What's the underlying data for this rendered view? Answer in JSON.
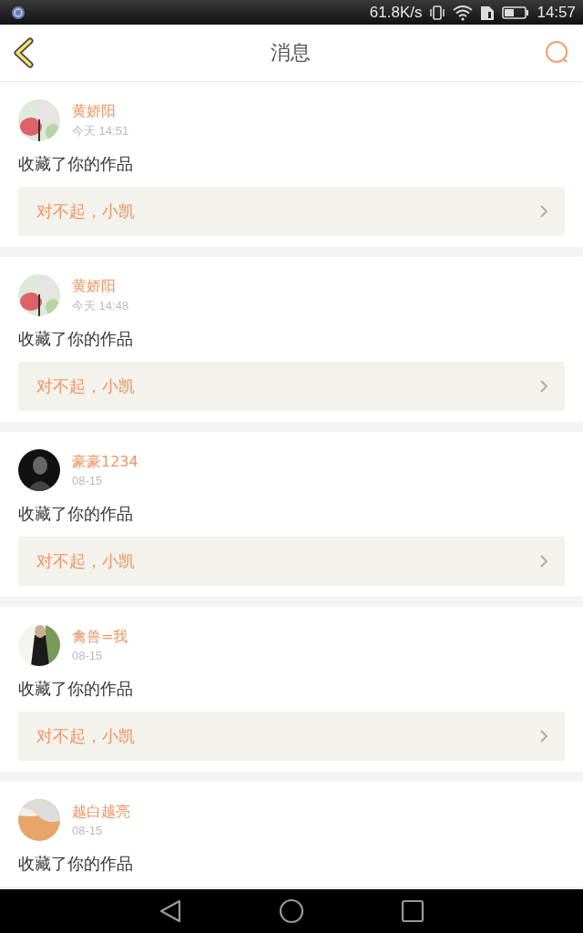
{
  "status_bar": {
    "speed": "61.8K/s",
    "time": "14:57"
  },
  "header": {
    "title": "消息"
  },
  "messages": [
    {
      "name": "黄娇阳",
      "time": "今天 14:51",
      "action": "收藏了你的作品",
      "quote": "对不起，小凯"
    },
    {
      "name": "黄娇阳",
      "time": "今天 14:48",
      "action": "收藏了你的作品",
      "quote": "对不起，小凯"
    },
    {
      "name": "豪豪1234",
      "time": "08-15",
      "action": "收藏了你的作品",
      "quote": "对不起，小凯"
    },
    {
      "name": "禽兽=我",
      "time": "08-15",
      "action": "收藏了你的作品",
      "quote": "对不起，小凯"
    },
    {
      "name": "越白越亮",
      "time": "08-15",
      "action": "收藏了你的作品"
    }
  ]
}
